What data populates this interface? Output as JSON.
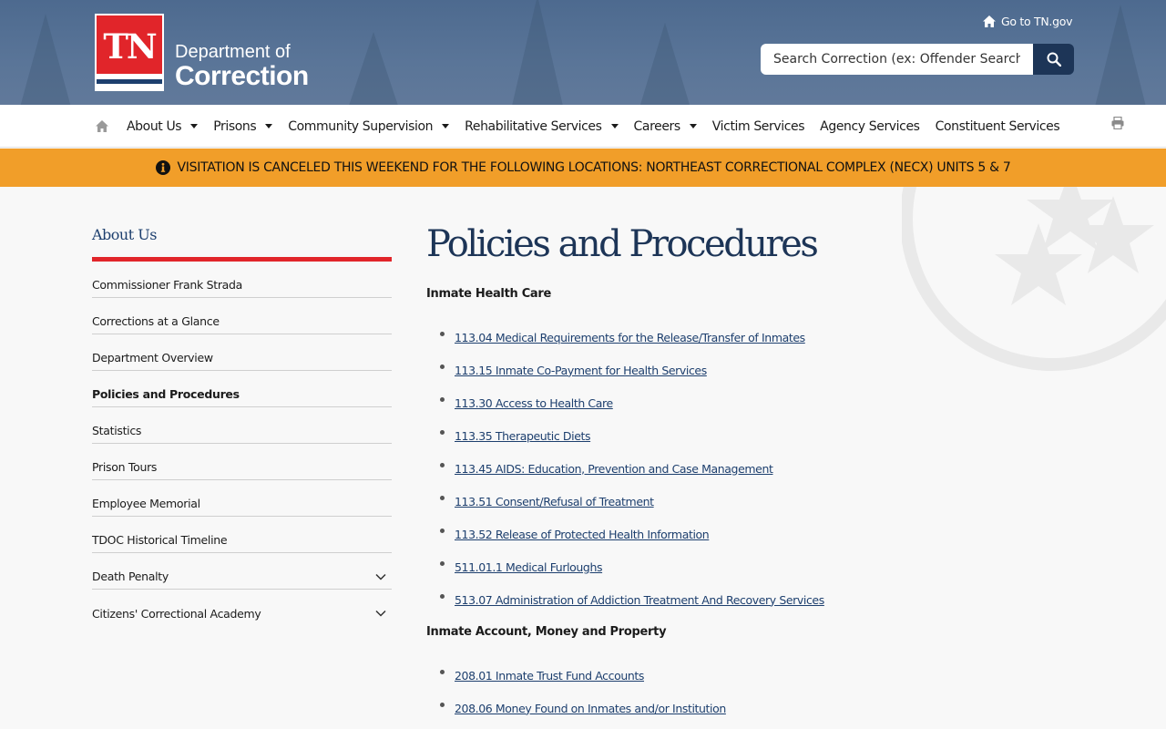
{
  "header": {
    "logo_mark": "TN",
    "logo_line1": "Department of",
    "logo_line2": "Correction",
    "goto_label": "Go to TN.gov",
    "search_placeholder": "Search Correction (ex: Offender Search)"
  },
  "nav": {
    "items": [
      {
        "label": "About Us",
        "dropdown": true
      },
      {
        "label": "Prisons",
        "dropdown": true
      },
      {
        "label": "Community Supervision",
        "dropdown": true
      },
      {
        "label": "Rehabilitative Services",
        "dropdown": true
      },
      {
        "label": "Careers",
        "dropdown": true
      },
      {
        "label": "Victim Services",
        "dropdown": false
      },
      {
        "label": "Agency Services",
        "dropdown": false
      },
      {
        "label": "Constituent Services",
        "dropdown": false
      }
    ]
  },
  "alert": {
    "text": "VISITATION IS CANCELED THIS WEEKEND FOR THE FOLLOWING LOCATIONS: NORTHEAST CORRECTIONAL COMPLEX (NECX) UNITS 5 & 7"
  },
  "sidebar": {
    "title": "About Us",
    "items": [
      {
        "label": "Commissioner Frank Strada",
        "active": false,
        "expandable": false
      },
      {
        "label": "Corrections at a Glance",
        "active": false,
        "expandable": false
      },
      {
        "label": "Department Overview",
        "active": false,
        "expandable": false
      },
      {
        "label": "Policies and Procedures",
        "active": true,
        "expandable": false
      },
      {
        "label": "Statistics",
        "active": false,
        "expandable": false
      },
      {
        "label": "Prison Tours",
        "active": false,
        "expandable": false
      },
      {
        "label": "Employee Memorial",
        "active": false,
        "expandable": false
      },
      {
        "label": "TDOC Historical Timeline",
        "active": false,
        "expandable": false
      },
      {
        "label": "Death Penalty",
        "active": false,
        "expandable": true
      },
      {
        "label": "Citizens' Correctional Academy",
        "active": false,
        "expandable": true
      }
    ]
  },
  "main": {
    "title": "Policies and Procedures",
    "sections": [
      {
        "heading": "Inmate Health Care",
        "links": [
          "113.04 Medical Requirements for the Release/Transfer of Inmates",
          "113.15 Inmate Co-Payment for Health Services",
          "113.30 Access to Health Care",
          "113.35 Therapeutic Diets",
          "113.45 AIDS: Education, Prevention and Case Management",
          "113.51 Consent/Refusal of Treatment",
          "113.52 Release of Protected Health Information",
          "511.01.1 Medical Furloughs",
          "513.07 Administration of Addiction Treatment And Recovery Services"
        ]
      },
      {
        "heading": "Inmate Account, Money and Property",
        "links": [
          "208.01 Inmate Trust Fund Accounts",
          "208.06 Money Found on Inmates and/or Institution"
        ]
      }
    ]
  },
  "colors": {
    "header_bg": "#5a7598",
    "brand_red": "#e1252a",
    "navy": "#1d3557",
    "alert_bg": "#f19e29",
    "link": "#1d3f6e"
  }
}
